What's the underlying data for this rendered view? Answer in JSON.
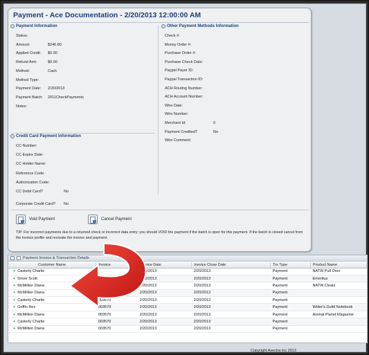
{
  "window": {
    "title": "Payment - Ace Documentation - 2/20/2013 12:00:00 AM"
  },
  "payment_info": {
    "heading": "Payment Information",
    "icon": "info-circle-icon",
    "fields": [
      {
        "label": "Status:",
        "value": ""
      },
      {
        "label": "Amount:",
        "value": "$246.80"
      },
      {
        "label": "Applied Credit:",
        "value": "$0.00"
      },
      {
        "label": "Refund Amt:",
        "value": "$0.00"
      },
      {
        "label": "Method:",
        "value": "Cash"
      },
      {
        "label": "Method Type:",
        "value": ""
      },
      {
        "label": "Payment Date:",
        "value": "2/20/2013"
      },
      {
        "label": "Payment Batch:",
        "value": "2011CheckPayments"
      },
      {
        "label": "Notes:",
        "value": ""
      }
    ]
  },
  "other_methods": {
    "heading": "Other Payment Methods Information",
    "icon": "info-circle-icon",
    "fields": [
      {
        "label": "Check #:",
        "value": ""
      },
      {
        "label": "Money Order #:",
        "value": ""
      },
      {
        "label": "Purchase Order #:",
        "value": ""
      },
      {
        "label": "Purchase Check Date:",
        "value": ""
      },
      {
        "label": "Paypal Payer ID:",
        "value": ""
      },
      {
        "label": "Paypal Transaction ID:",
        "value": ""
      },
      {
        "label": "ACH Routing Number:",
        "value": ""
      },
      {
        "label": "ACH Account Number:",
        "value": ""
      },
      {
        "label": "Wire Date:",
        "value": ""
      },
      {
        "label": "Wire Number:",
        "value": ""
      },
      {
        "label": "Merchant Id:",
        "value": "0"
      },
      {
        "label": "Payment Credited?",
        "value": "No"
      },
      {
        "label": "Wire Comment:",
        "value": ""
      }
    ]
  },
  "credit_card": {
    "heading": "Credit Card Payment Information",
    "icon": "info-circle-icon",
    "fields": [
      {
        "label": "CC Number:",
        "value": ""
      },
      {
        "label": "CC Expire Date:",
        "value": ""
      },
      {
        "label": "CC Holder Name:",
        "value": ""
      },
      {
        "label": "Reference Code:",
        "value": ""
      },
      {
        "label": "Authorization Code:",
        "value": ""
      },
      {
        "label": "CC Debit Card?",
        "value": "No"
      },
      {
        "label": "Corporate Credit Card?",
        "value": "No"
      }
    ]
  },
  "actions": {
    "void_label": "Void Payment",
    "cancel_label": "Cancel Payment"
  },
  "tip": "TIP: For incorrect payments due to a returned check or incorrect data entry: you should VOID the payment if the batch is open for this payment. If the batch is closed cancel from the invoice profile and recreate the invoice and payment.",
  "grid": {
    "title": "Payment Invoice & Transaction Details",
    "columns": [
      "Customer Name",
      "Invoice",
      "Invoice Date",
      "Invoice Close Date",
      "Trx Type",
      "Product Name"
    ],
    "rows": [
      [
        "Casterly Charlie",
        "",
        "2/20/2013",
        "2/20/2013",
        "Payment",
        "NATW Pull Over"
      ],
      [
        "Driver Scott",
        "",
        "2/20/2013",
        "2/20/2013",
        "Payment",
        "Emeritus"
      ],
      [
        "McMillion Diana",
        "",
        "2/20/2013",
        "2/20/2013",
        "Payment",
        "NATW Cleats"
      ],
      [
        "McMillion Diana",
        "",
        "2/20/2013",
        "2/20/2013",
        "Payment",
        ""
      ],
      [
        "Casterly Charlie",
        "003570",
        "2/20/2013",
        "2/20/2013",
        "Payment",
        ""
      ],
      [
        "Griffin Rex",
        "003570",
        "2/20/2013",
        "2/20/2013",
        "Payment",
        "Writer's Guild Notebook"
      ],
      [
        "McMillion Diana",
        "003570",
        "2/20/2013",
        "2/20/2013",
        "Payment",
        "Animal Planet Magazine"
      ],
      [
        "Casterly Charlie",
        "003570",
        "2/20/2013",
        "2/20/2013",
        "Payment",
        ""
      ],
      [
        "McMillion Diana",
        "003570",
        "2/20/2013",
        "2/20/2013",
        "Payment",
        ""
      ]
    ]
  },
  "footer": {
    "copyright": "Copyright Avectra Inc 2013"
  },
  "colors": {
    "title_blue": "#1f3f78",
    "arrow_red": "#d42020",
    "expand_green": "#2c8a2c"
  }
}
